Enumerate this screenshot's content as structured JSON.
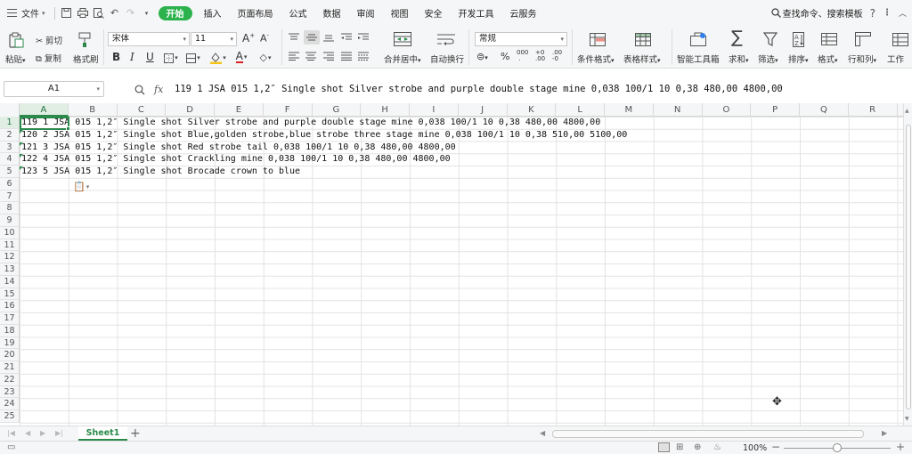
{
  "menubar": {
    "file_label": "文件",
    "tabs": [
      "开始",
      "插入",
      "页面布局",
      "公式",
      "数据",
      "审阅",
      "视图",
      "安全",
      "开发工具",
      "云服务"
    ],
    "active_tab": "开始",
    "search_label": "查找命令、搜索模板",
    "help_icon": "?"
  },
  "ribbon": {
    "paste": "粘贴",
    "cut": "剪切",
    "copy": "复制",
    "format_painter": "格式刷",
    "font_name": "宋体",
    "font_size": "11",
    "merge_center": "合并居中",
    "wrap_text": "自动换行",
    "number_format": "常规",
    "conditional_format": "条件格式",
    "table_style": "表格样式",
    "smart_toolbox": "智能工具箱",
    "sum": "求和",
    "filter": "筛选",
    "sort": "排序",
    "format": "格式",
    "row_col": "行和列",
    "worksheet": "工作"
  },
  "formulabar": {
    "name_box": "A1",
    "fx": "fx",
    "content": "119 1 JSA 015 1,2″ Single shot Silver strobe and purple double stage mine 0,038 100/1 10 0,38 480,00 4800,00"
  },
  "grid": {
    "columns": [
      "A",
      "B",
      "C",
      "D",
      "E",
      "F",
      "G",
      "H",
      "I",
      "J",
      "K",
      "L",
      "M",
      "N",
      "O",
      "P",
      "Q",
      "R"
    ],
    "selected_column": "A",
    "rows": [
      "1",
      "2",
      "3",
      "4",
      "5",
      "6",
      "7",
      "8",
      "9",
      "10",
      "11",
      "12",
      "13",
      "14",
      "15",
      "16",
      "17",
      "18",
      "19",
      "20",
      "21",
      "22",
      "23",
      "24",
      "25"
    ],
    "selected_row": "1",
    "data": [
      "119 1 JSA 015 1,2″ Single shot Silver strobe and purple double stage mine 0,038 100/1 10 0,38 480,00 4800,00",
      "120 2 JSA 015 1,2″ Single shot Blue,golden strobe,blue strobe three stage mine 0,038 100/1 10 0,38 510,00 5100,00",
      "121 3 JSA 015 1,2″ Single shot Red strobe tail 0,038 100/1 10 0,38 480,00 4800,00",
      "122 4 JSA 015 1,2″ Single shot Crackling mine 0,038 100/1 10 0,38 480,00 4800,00",
      "123 5 JSA 015 1,2″ Single shot Brocade crown to blue"
    ]
  },
  "sheets": {
    "active": "Sheet1",
    "add": "+"
  },
  "statusbar": {
    "zoom": "100%",
    "zoom_fraction": 0.5
  }
}
